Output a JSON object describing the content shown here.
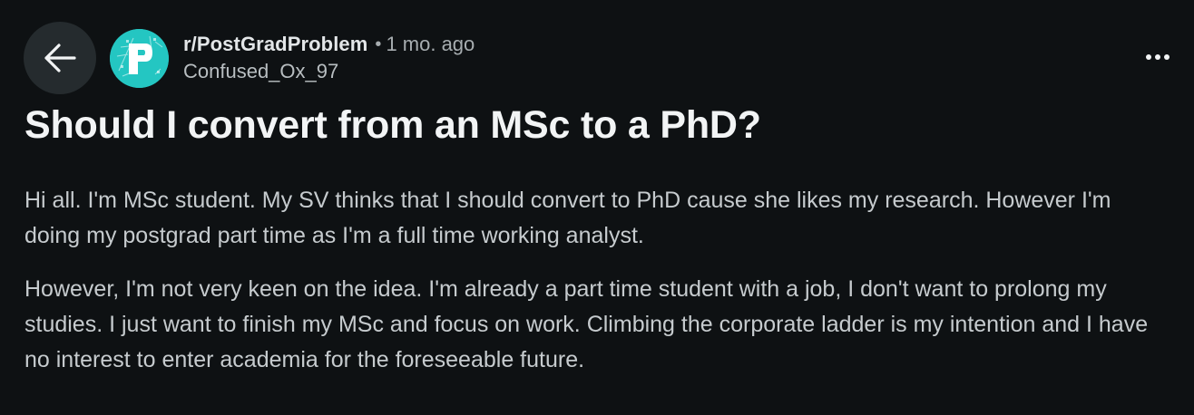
{
  "header": {
    "back_icon": "arrow-left-icon",
    "community_avatar_letter": "P",
    "subreddit": "r/PostGradProblem",
    "separator": "•",
    "age": "1 mo. ago",
    "author": "Confused_Ox_97",
    "more_icon": "more-horizontal-icon"
  },
  "post": {
    "title": "Should I convert from an MSc to a PhD?",
    "paragraphs": [
      "Hi all. I'm MSc student. My SV thinks that I should convert to PhD cause she likes my research. However I'm doing my postgrad part time as I'm a full time working analyst.",
      "However, I'm not very keen on the idea. I'm already a part time student with a job, I don't want to prolong my studies. I just want to finish my MSc and focus on work. Climbing the corporate ladder is my intention and I have no interest to enter academia for the foreseeable future."
    ]
  },
  "colors": {
    "background": "#0e1113",
    "button_bg": "#252b2e",
    "avatar_bg": "#24c6c2",
    "title_text": "#f2f4f5",
    "body_text": "#c6cbce",
    "muted_text": "#a7adb0"
  }
}
